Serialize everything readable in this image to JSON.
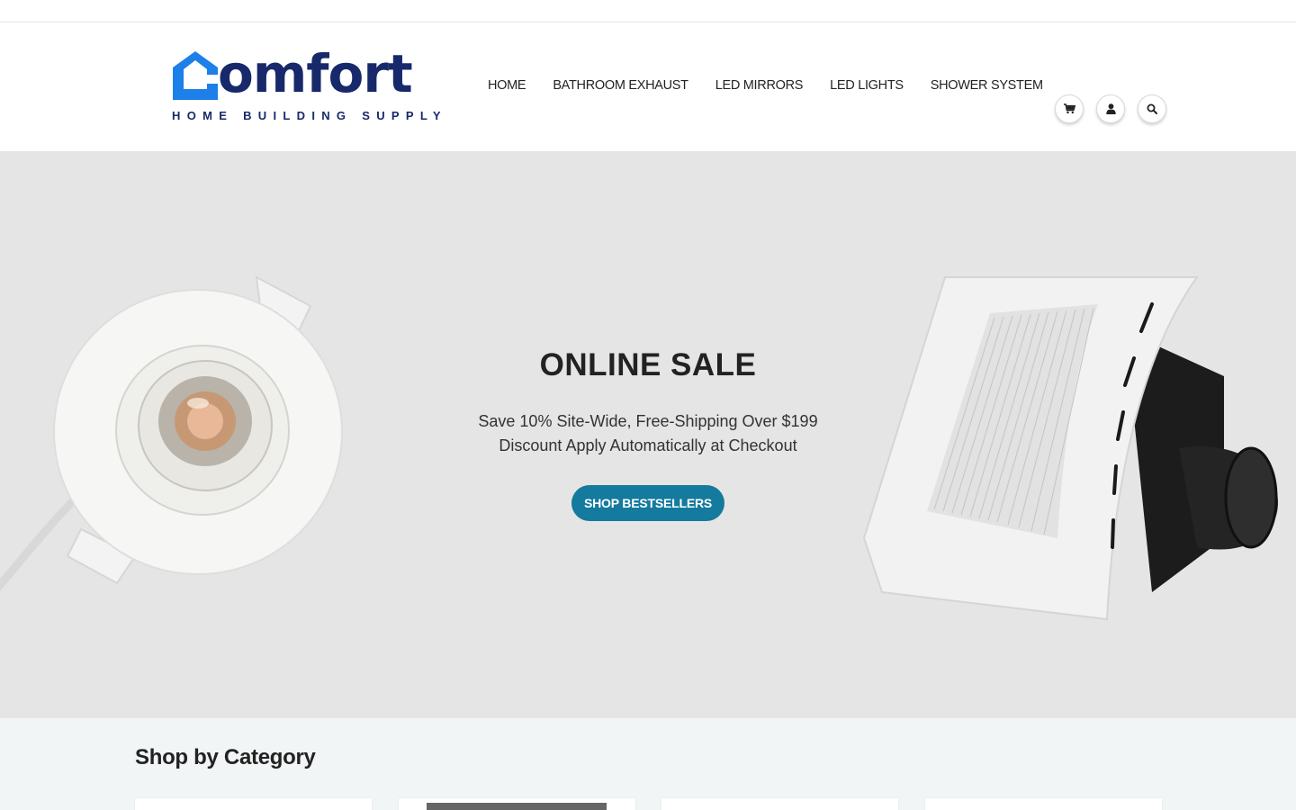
{
  "brand": {
    "wordmark": "omfort",
    "tagline": "HOME BUILDING SUPPLY",
    "primary_color": "#17296a",
    "accent_color": "#1d7fe8"
  },
  "nav": {
    "items": [
      {
        "label": "HOME"
      },
      {
        "label": "BATHROOM EXHAUST"
      },
      {
        "label": "LED MIRRORS"
      },
      {
        "label": "LED LIGHTS"
      },
      {
        "label": "SHOWER SYSTEM"
      }
    ]
  },
  "header_icons": {
    "cart": "cart-icon",
    "account": "user-icon",
    "search": "search-icon"
  },
  "hero": {
    "title": "ONLINE SALE",
    "line1": "Save 10% Site-Wide, Free-Shipping Over $199",
    "line2": "Discount Apply Automatically at Checkout",
    "button_label": "SHOP BESTSELLERS",
    "button_color": "#147a9e",
    "background_color": "#e5e5e5"
  },
  "category": {
    "title": "Shop by Category"
  }
}
